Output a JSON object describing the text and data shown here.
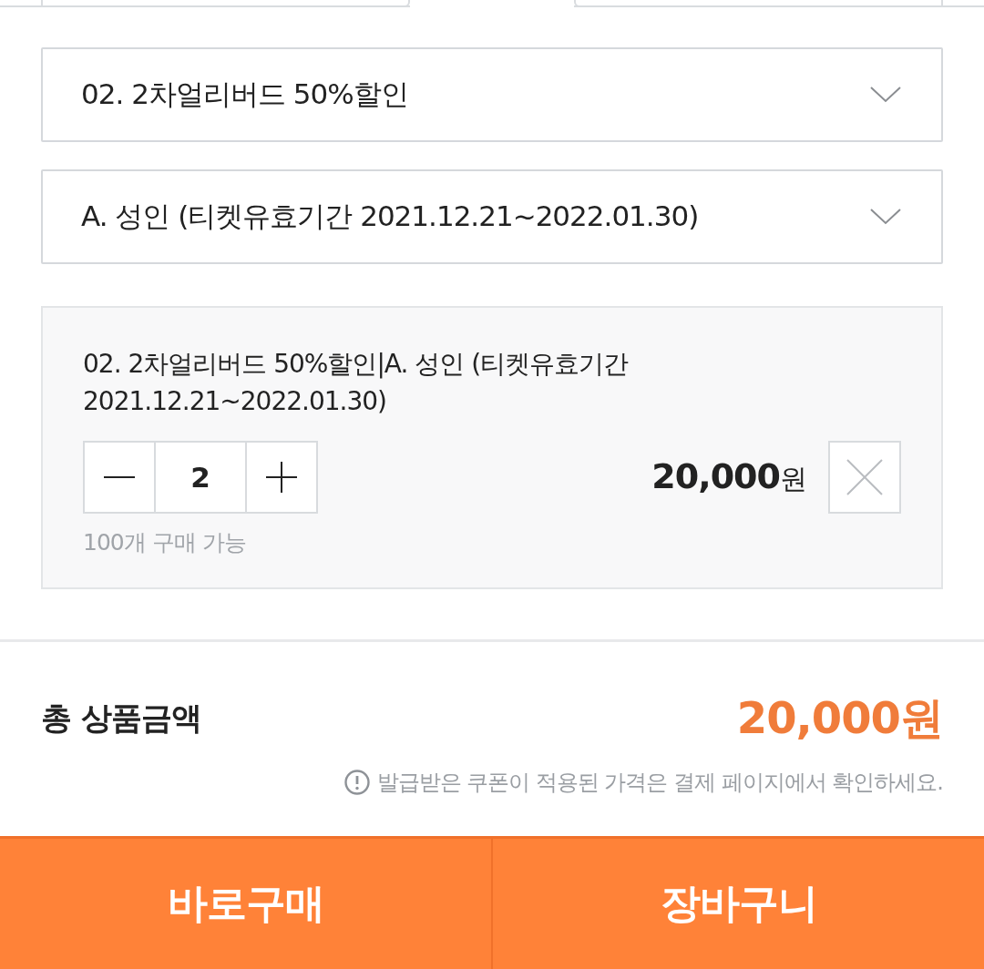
{
  "option_selects": [
    {
      "value": "02. 2차얼리버드 50%할인"
    },
    {
      "value": "A. 성인 (티켓유효기간 2021.12.21~2022.01.30)"
    }
  ],
  "selected_items": [
    {
      "name": "02. 2차얼리버드 50%할인|A. 성인 (티켓유효기간 2021.12.21~2022.01.30)",
      "quantity": "2",
      "price": "**20,000**원",
      "stock_note": "100개 구매 가능"
    }
  ],
  "total": {
    "label": "총 상품금액",
    "amount": "20,000원",
    "notice": "발급받은 쿠폰이 적용된 가격은 결제 페이지에서 확인하세요."
  },
  "buttons": [
    {
      "label": "바로구매"
    },
    {
      "label": "장바구니"
    }
  ]
}
